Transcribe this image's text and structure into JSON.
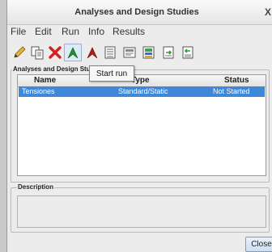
{
  "window": {
    "title": "Analyses and Design Studies",
    "close_glyph": "X"
  },
  "menu": {
    "file": "File",
    "edit": "Edit",
    "run": "Run",
    "info": "Info",
    "results": "Results"
  },
  "toolbar": {
    "icons": [
      "edit-pencil-icon",
      "copy-icon",
      "delete-x-icon",
      "start-run-flag-icon",
      "stop-run-flag-icon",
      "list-icon",
      "display-icon",
      "results-icon",
      "export-icon",
      "import-icon"
    ],
    "tooltip": "Start run"
  },
  "studies_group": {
    "label": "Analyses and Design Studies",
    "columns": {
      "name": "Name",
      "type": "Type",
      "status": "Status"
    },
    "rows": [
      {
        "name": "Tensiones",
        "type": "Standard/Static",
        "status": "Not Started",
        "selected": true
      }
    ]
  },
  "description_group": {
    "label": "Description",
    "value": ""
  },
  "buttons": {
    "close": "Close"
  },
  "colors": {
    "selection": "#3f88d8",
    "delete_red": "#d61f1f",
    "flag_green": "#1f8f2e",
    "flag_red": "#b21d1d"
  }
}
